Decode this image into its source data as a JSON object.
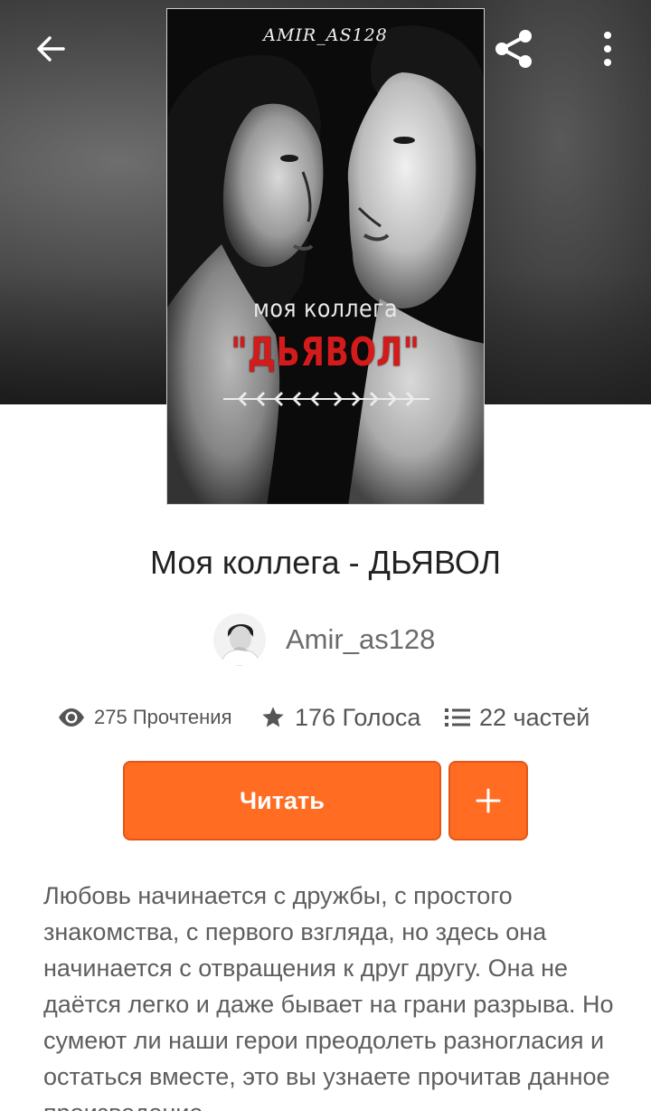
{
  "header": {
    "back_icon": "arrow-left-icon",
    "share_icon": "share-icon",
    "more_icon": "more-vertical-icon"
  },
  "cover": {
    "author_text": "AMIR_AS128",
    "title_line1": "моя коллега",
    "title_line2": "\"ДЬЯВОЛ\""
  },
  "book": {
    "title": "Моя коллега - ДЬЯВОЛ",
    "author": "Amir_as128"
  },
  "stats": {
    "reads": "275 Прочтения",
    "votes": "176 Голоса",
    "parts": "22 частей"
  },
  "actions": {
    "read_label": "Читать",
    "add_icon": "plus-icon"
  },
  "description": "Любовь начинается с дружбы, с простого знакомства, с первого взгляда, но здесь она начинается с отвращения к друг другу. Она не даётся легко и даже бывает на грани разрыва. Но сумеют ли наши герои преодолеть разногласия и остаться вместе, это вы узнаете прочитав данное произведение.",
  "colors": {
    "accent": "#ff6c22",
    "accent_border": "#e2561a",
    "text_primary": "#222222",
    "text_secondary": "#6b6b6b"
  }
}
